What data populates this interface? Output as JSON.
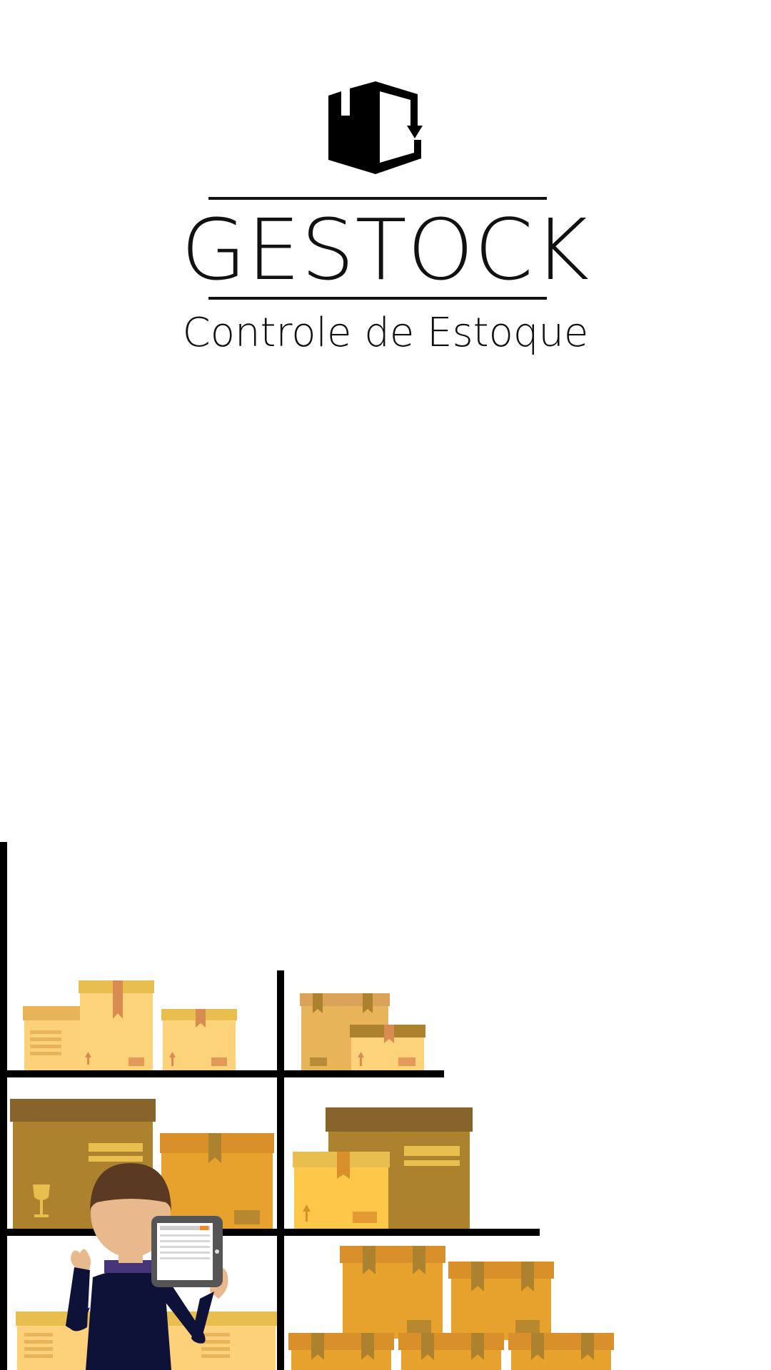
{
  "app": {
    "title": "GESTOCK",
    "subtitle": "Controle de Estoque"
  },
  "logo": {
    "icon": "box-return-icon"
  },
  "illustration": {
    "icons": [
      "warehouse-shelf",
      "cardboard-box",
      "worker-with-tablet"
    ],
    "colors": {
      "light": "#fcd37a",
      "pale": "#fdd17a",
      "medium": "#e8b45a",
      "orange": "#e6a22c",
      "brown": "#ad822f",
      "dark_brown": "#86642b",
      "tape": "#d98c50",
      "shelf": "#000000",
      "shirt": "#0f1238"
    }
  }
}
